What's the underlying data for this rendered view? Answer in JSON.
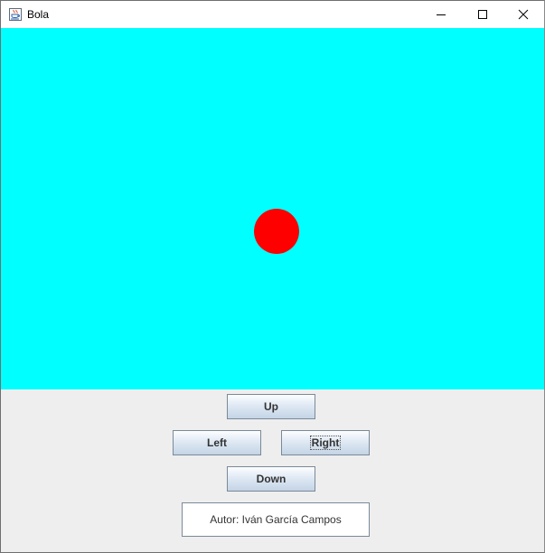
{
  "window": {
    "title": "Bola",
    "icon": "java-cup-icon",
    "controls": [
      "minimize-icon",
      "maximize-icon",
      "close-icon"
    ]
  },
  "canvas": {
    "background": "#00ffff",
    "ball_color": "#ff0000"
  },
  "buttons": {
    "up": "Up",
    "left": "Left",
    "right": "Right",
    "down": "Down"
  },
  "author": "Autor: Iván García Campos"
}
